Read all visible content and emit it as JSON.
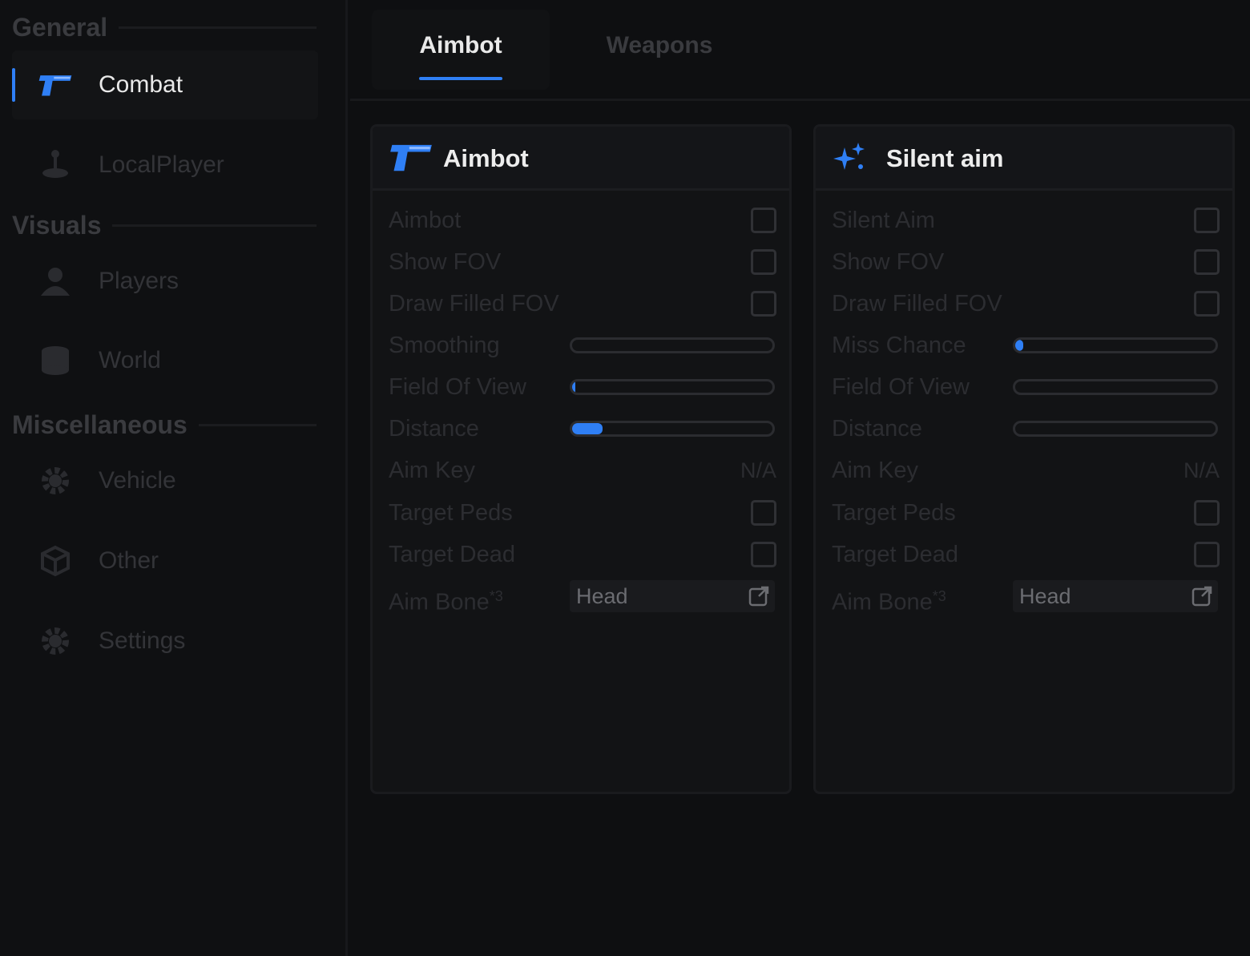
{
  "sidebar": {
    "sections": {
      "general": "General",
      "visuals": "Visuals",
      "misc": "Miscellaneous"
    },
    "items": {
      "combat": "Combat",
      "localplayer": "LocalPlayer",
      "players": "Players",
      "world": "World",
      "vehicle": "Vehicle",
      "other": "Other",
      "settings": "Settings"
    }
  },
  "tabs": {
    "aimbot": "Aimbot",
    "weapons": "Weapons"
  },
  "colors": {
    "accent": "#2f7ff5",
    "background": "#0e0f11"
  },
  "aimbot_panel": {
    "title": "Aimbot",
    "icon": "pistol-icon",
    "aimbot_label": "Aimbot",
    "show_fov_label": "Show FOV",
    "draw_filled_fov_label": "Draw Filled FOV",
    "smoothing_label": "Smoothing",
    "smoothing_value": 0,
    "fov_label": "Field Of View",
    "fov_value": 0.01,
    "distance_label": "Distance",
    "distance_value": 0.15,
    "aim_key_label": "Aim Key",
    "aim_key_value": "N/A",
    "target_peds_label": "Target Peds",
    "target_dead_label": "Target Dead",
    "aim_bone_label": "Aim Bone",
    "aim_bone_sup": "*3",
    "aim_bone_value": "Head"
  },
  "silent_panel": {
    "title": "Silent aim",
    "icon": "sparkles-icon",
    "silent_aim_label": "Silent Aim",
    "show_fov_label": "Show FOV",
    "draw_filled_fov_label": "Draw Filled FOV",
    "miss_chance_label": "Miss Chance",
    "miss_chance_value": 0.04,
    "fov_label": "Field Of View",
    "fov_value": 0,
    "distance_label": "Distance",
    "distance_value": 0,
    "aim_key_label": "Aim Key",
    "aim_key_value": "N/A",
    "target_peds_label": "Target Peds",
    "target_dead_label": "Target Dead",
    "aim_bone_label": "Aim Bone",
    "aim_bone_sup": "*3",
    "aim_bone_value": "Head"
  }
}
